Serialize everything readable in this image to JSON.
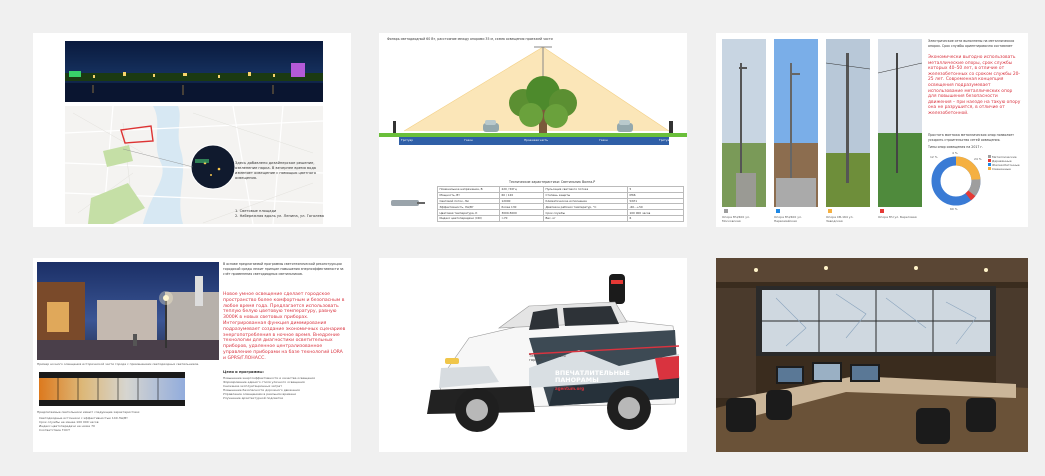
{
  "slide1": {
    "caption": "Здесь добавлено дизайнерское решение, озеленение парка. В вечернее время вода изменяет освещение с помощью цветного освещения.",
    "list": [
      "1. Световые площади",
      "2. Набережная вдоль ул. Ленина, ул. Гоголева"
    ]
  },
  "slide2": {
    "header": "Фонарь светодиодный 60 Вт, расстояние между опорами 35 м, схема освещения проезжей части",
    "road_labels": [
      "Тротуар",
      "Газон",
      "Проезжая часть",
      "Газон",
      "Тротуар"
    ],
    "spec_title": "Технические характеристики: Светильник Волна-Р",
    "specs_left": [
      [
        "Номинальное напряжение, В",
        "220 / 50Гц"
      ],
      [
        "Мощность, Вт",
        "60 / 120"
      ],
      [
        "Световой поток, Лм",
        "12000"
      ],
      [
        "Эффективность, Лм/Вт",
        "более 130"
      ],
      [
        "Цветовая температура, К",
        "3000-5000"
      ],
      [
        "Индекс цветопередачи (CRI)",
        ">70"
      ]
    ],
    "specs_right": [
      [
        "Пульсация светового потока",
        "5"
      ],
      [
        "Степень защиты",
        "IP66"
      ],
      [
        "Климатическое исполнение",
        "УХЛ1"
      ],
      [
        "Диапазон рабочих температур, °С",
        "-60...+50"
      ],
      [
        "Срок службы",
        "100 000 часов"
      ],
      [
        "Вес, кг",
        "6"
      ]
    ]
  },
  "slide3": {
    "intro": "Электрические сети выполнены на металлических опорах. Срок службы ориентировочно составляет",
    "highlight": "Экономически выгодно использовать металлические опоры, срок службы которых 40–50 лет, в отличие от железобетонных со сроком службы 20-25 лет. Современная концепция освещения подразумевает использование металлических опор для повышения безопасности движения – при наезде на такую опору она не разрушится, в отличие от железобетонной.",
    "note": "Простота монтажа металлических опор позволяет ускорить строительство сетей освещения.",
    "chart_title": "Типы опор освещения на 2017 г.",
    "photo_captions": [
      "Опора МЧ/400 ул. Московская",
      "Опора МЧ/400 ул. Первомайская",
      "Опора СВ-164 ул. Заводская",
      "Опора МЧ ул. Береговая"
    ],
    "legend": [
      "Металлические",
      "Деревянные",
      "Железобетонные",
      "Смешанные"
    ],
    "legend_colors": [
      "#9e9e9e",
      "#e53935",
      "#1e88e5",
      "#f5b041"
    ],
    "pct_labels": [
      "12 %",
      "4 %",
      "24 %",
      "60 %"
    ]
  },
  "slide4": {
    "body": "В основе предлагаемой программы светотехнической реконструкции городской среды лежит принцип повышения энергоэффективности за счёт применения светодиодных светильников.",
    "highlight": "Новое умное освещение сделает городское пространство более комфортным и безопасным в любое время года. Предлагается использовать теплую белую цветовую температуру, равную 3000К в новых световых приборах. Интегрированная функция диммирования подразумевает создание экономичных сценариев энергопотребления в ночное время. Внедрение технологии для диагностики осветительных приборов, удаленное централизованное управление приборами на базе технологий LORA и GPRS/ГЛОНАСС.",
    "photo_caption": "Пример ночного освещения исторической части города с применением светодиодных светильников.",
    "goals_title": "Цели и программы:",
    "goals": [
      "Повышение энергоэффективности и качества освещения",
      "Формирование единого стиля уличного освещения",
      "Снижение эксплуатационных затрат",
      "Повышение безопасности дорожного движения",
      "Управление освещением в реальном времени",
      "Улучшение архитектурной подсветки"
    ],
    "cct_title": "Предлагаемые светильники имеют следующие характеристики:",
    "cct_list": [
      "Светодиодные источники с эффективностью 140 Лм/Вт",
      "Срок службы не менее 100 000 часов",
      "Индекс цветопередачи не ниже 70",
      "Соответствие ГОСТ"
    ]
  },
  "slide5": {
    "door_logo": "Технологии умного города",
    "door_title": "ВПЕЧАТЛИТЕЛЬНЫЕ ПАНОРАМЫ",
    "door_url": "agentum.org"
  },
  "colors": {
    "accent_red": "#d9333f",
    "donut_blue": "#3a7bd5",
    "donut_orange": "#f5b041",
    "donut_grey": "#9e9e9e"
  }
}
